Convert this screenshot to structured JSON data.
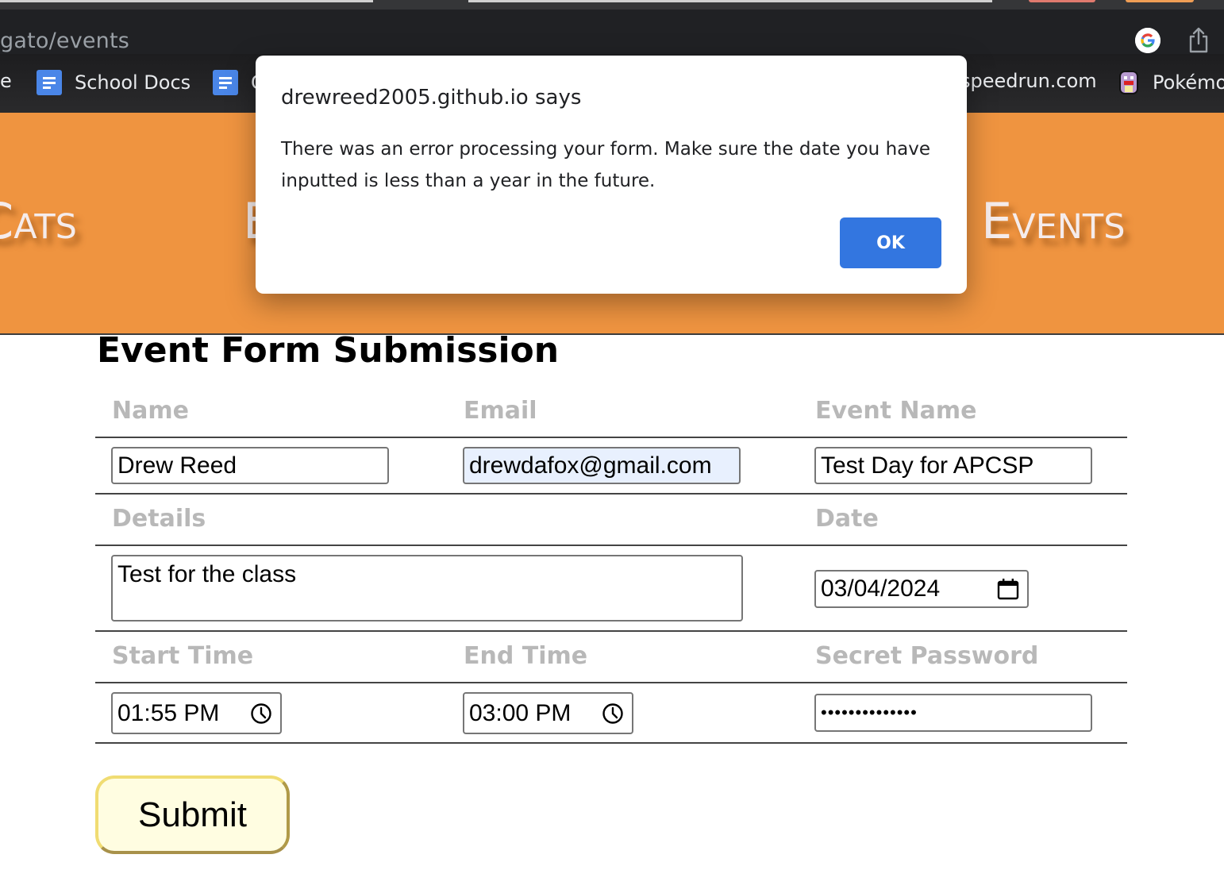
{
  "browser": {
    "url_fragment": "gato/events",
    "bookmarks": [
      {
        "label": "e",
        "icon": "bookmark-icon"
      },
      {
        "label": "School Docs",
        "icon": "google-docs-icon"
      },
      {
        "label": "G",
        "icon": "google-docs-icon"
      },
      {
        "label": "speedrun.com",
        "icon": "none"
      },
      {
        "label": "Pokémo",
        "icon": "pokemon-sprite-icon"
      }
    ],
    "toolbar_icons": [
      "google-icon",
      "share-icon"
    ]
  },
  "site_nav": {
    "items": [
      {
        "label": "Cats"
      },
      {
        "label": "E"
      },
      {
        "label": "Events"
      }
    ]
  },
  "form": {
    "title": "Event Form Submission",
    "labels": {
      "name": "Name",
      "email": "Email",
      "event_name": "Event Name",
      "details": "Details",
      "date": "Date",
      "start_time": "Start Time",
      "end_time": "End Time",
      "secret_password": "Secret Password"
    },
    "values": {
      "name": "Drew Reed",
      "email": "drewdafox@gmail.com",
      "event_name": "Test Day for APCSP",
      "details": "Test for the class",
      "date": "03/04/2024",
      "start_time": "01:55 PM",
      "end_time": "03:00 PM",
      "secret_password": "••••••••••••••"
    },
    "submit_label": "Submit"
  },
  "alert": {
    "title": "drewreed2005.github.io says",
    "message": "There was an error processing your form. Make sure the date you have inputted is less than a year in the future.",
    "ok_label": "OK",
    "ok_color": "#3376e0"
  },
  "colors": {
    "banner": "#ef9440",
    "label_gray": "#b8b8b8",
    "submit_bg": "#fffde1",
    "submit_border": "#f0dc72"
  }
}
